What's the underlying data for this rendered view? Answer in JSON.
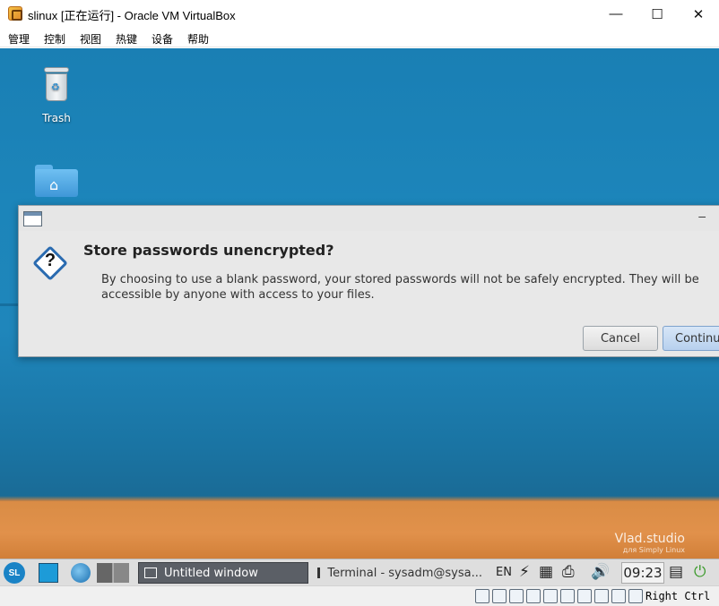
{
  "window": {
    "title": "slinux [正在运行] - Oracle VM VirtualBox",
    "minimize_glyph": "—",
    "maximize_glyph": "☐",
    "close_glyph": "✕"
  },
  "menubar": {
    "items": [
      "管理",
      "控制",
      "视图",
      "热键",
      "设备",
      "帮助"
    ]
  },
  "desktop": {
    "icons": [
      {
        "label": "Trash",
        "icon": "trash-icon"
      },
      {
        "label": "",
        "icon": "home-folder-icon"
      }
    ],
    "watermark": {
      "brand": "Vlad.studio",
      "sub": "для Simply Linux"
    }
  },
  "dialog": {
    "title": "Store passwords unencrypted?",
    "message": "By choosing to use a blank password, your stored passwords will not be safely encrypted. They will be accessible by anyone with access to your files.",
    "cancel_label": "Cancel",
    "continue_label": "Continue",
    "minimize_glyph": "–"
  },
  "panel": {
    "logo": "SL",
    "tasks": [
      {
        "label": "Untitled window",
        "active": true
      },
      {
        "label": "Terminal - sysadm@sysa...",
        "active": false
      }
    ],
    "keyboard_layout": "EN",
    "clock": "09:23"
  },
  "statusbar": {
    "host_key": "Right Ctrl"
  }
}
